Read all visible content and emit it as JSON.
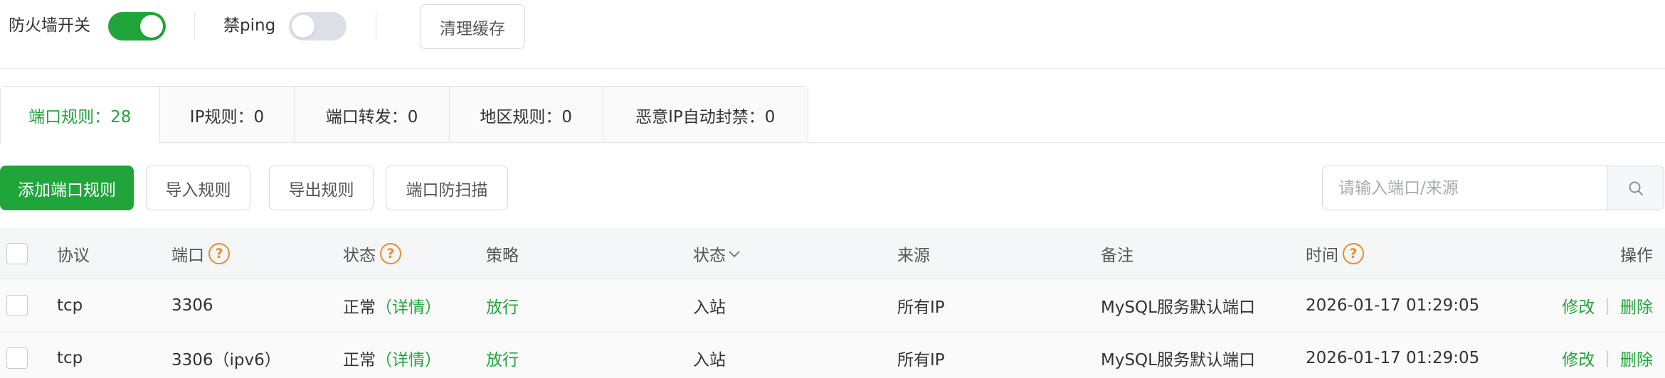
{
  "top": {
    "firewall_label": "防火墙开关",
    "firewall_on": true,
    "ping_label": "禁ping",
    "ping_on": false,
    "clear_cache": "清理缓存"
  },
  "tabs": [
    {
      "label": "端口规则：28",
      "active": true
    },
    {
      "label": "IP规则：0",
      "active": false
    },
    {
      "label": "端口转发：0",
      "active": false
    },
    {
      "label": "地区规则：0",
      "active": false
    },
    {
      "label": "恶意IP自动封禁：0",
      "active": false
    }
  ],
  "toolbar": {
    "add": "添加端口规则",
    "import": "导入规则",
    "export": "导出规则",
    "scan": "端口防扫描",
    "search_placeholder": "请输入端口/来源"
  },
  "table": {
    "headers": {
      "protocol": "协议",
      "port": "端口",
      "status": "状态",
      "policy": "策略",
      "direction": "状态",
      "source": "来源",
      "remark": "备注",
      "time": "时间",
      "actions": "操作"
    },
    "rows": [
      {
        "protocol": "tcp",
        "port": "3306",
        "status": "正常",
        "detail": "（详情）",
        "policy": "放行",
        "direction": "入站",
        "source": "所有IP",
        "remark": "MySQL服务默认端口",
        "time": "2026-01-17 01:29:05",
        "edit": "修改",
        "delete": "删除"
      },
      {
        "protocol": "tcp",
        "port": "3306（ipv6）",
        "status": "正常",
        "detail": "（详情）",
        "policy": "放行",
        "direction": "入站",
        "source": "所有IP",
        "remark": "MySQL服务默认端口",
        "time": "2026-01-17 01:29:05",
        "edit": "修改",
        "delete": "删除"
      }
    ]
  },
  "colors": {
    "accent": "#20a53a",
    "help_icon": "#ef8a2b"
  },
  "icons": {
    "help": "question-circle-icon",
    "search": "search-icon",
    "sort": "chevron-down-icon"
  }
}
